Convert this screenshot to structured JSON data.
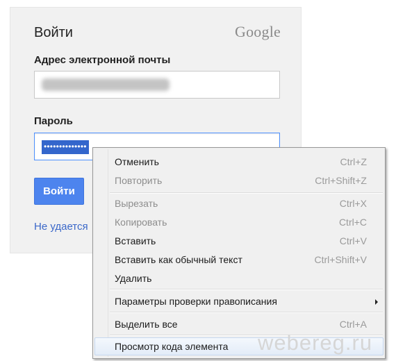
{
  "login": {
    "title": "Войти",
    "brand": "Google",
    "email_label": "Адрес электронной почты",
    "password_label": "Пароль",
    "password_value": "••••••••••••••",
    "signin_button": "Войти",
    "help_link": "Не удается"
  },
  "context_menu": {
    "items": [
      {
        "label": "Отменить",
        "shortcut": "Ctrl+Z",
        "enabled": true
      },
      {
        "label": "Повторить",
        "shortcut": "Ctrl+Shift+Z",
        "enabled": false
      },
      {
        "label": "Вырезать",
        "shortcut": "Ctrl+X",
        "enabled": false
      },
      {
        "label": "Копировать",
        "shortcut": "Ctrl+C",
        "enabled": false
      },
      {
        "label": "Вставить",
        "shortcut": "Ctrl+V",
        "enabled": true
      },
      {
        "label": "Вставить как обычный текст",
        "shortcut": "Ctrl+Shift+V",
        "enabled": true
      },
      {
        "label": "Удалить",
        "shortcut": "",
        "enabled": true
      },
      {
        "label": "Параметры проверки правописания",
        "shortcut": "",
        "enabled": true,
        "submenu": true
      },
      {
        "label": "Выделить все",
        "shortcut": "Ctrl+A",
        "enabled": true
      },
      {
        "label": "Просмотр кода элемента",
        "shortcut": "",
        "enabled": true,
        "highlighted": true
      }
    ]
  },
  "watermark": "webereg.ru",
  "colors": {
    "accent_button": "#4d84ee",
    "focus_border": "#4d90fe",
    "selection": "#3366cc",
    "link": "#3b68c9"
  }
}
